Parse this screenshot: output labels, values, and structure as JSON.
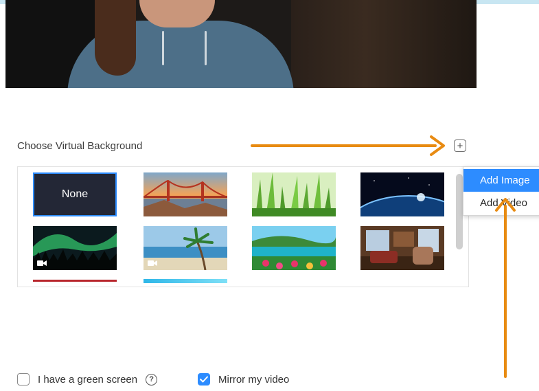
{
  "section": {
    "heading": "Choose Virtual Background"
  },
  "add_button": {
    "glyph": "+"
  },
  "backgrounds": [
    {
      "label": "None",
      "type": "none",
      "selected": true
    },
    {
      "label": "",
      "type": "image",
      "scene": "golden-gate-bridge"
    },
    {
      "label": "",
      "type": "image",
      "scene": "grass"
    },
    {
      "label": "",
      "type": "image",
      "scene": "earth-from-space"
    },
    {
      "label": "",
      "type": "video",
      "scene": "aurora"
    },
    {
      "label": "",
      "type": "video",
      "scene": "beach"
    },
    {
      "label": "",
      "type": "image",
      "scene": "tropical-coast"
    },
    {
      "label": "",
      "type": "image",
      "scene": "living-room"
    }
  ],
  "add_menu": {
    "items": [
      {
        "label": "Add Image",
        "active": true
      },
      {
        "label": "Add Video",
        "active": false
      }
    ]
  },
  "options": {
    "green_screen": {
      "label": "I have a green screen",
      "checked": false,
      "help_glyph": "?"
    },
    "mirror": {
      "label": "Mirror my video",
      "checked": true
    }
  },
  "colors": {
    "accent": "#2d8cff",
    "arrow": "#e88b12"
  }
}
